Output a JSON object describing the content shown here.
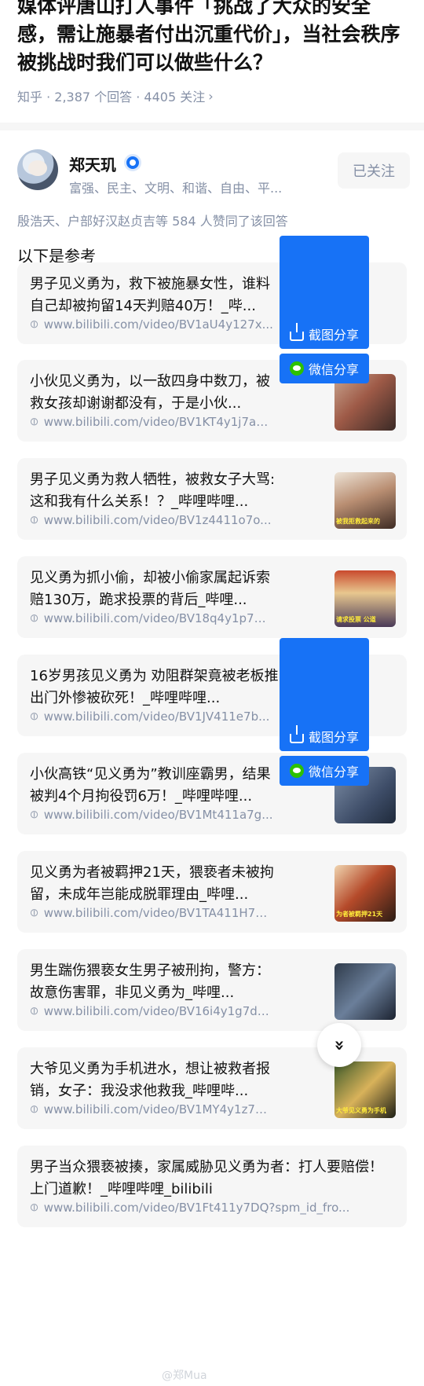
{
  "question": {
    "title": "媒体评唐山打人事件「挑战了大众的安全感，需让施暴者付出沉重代价」，当社会秩序被挑战时我们可以做些什么？",
    "meta": "知乎 · 2,387 个回答 · 4405 关注",
    "chevron": "›"
  },
  "author": {
    "name": "郑天玑",
    "bio": "富强、民主、文明、和谐、自由、平...",
    "follow_label": "已关注"
  },
  "likers": "殷浩天、户部好汉赵贞吉等 584 人赞同了该回答",
  "intro": "以下是参考",
  "cards": [
    {
      "title": "男子见义勇为，救下被施暴女性，谁料自己却被拘留14天判赔40万！_哔...",
      "url": "www.bilibili.com/video/BV1aU4y127x..."
    },
    {
      "title": "小伙见义勇为，以一敌四身中数刀，被救女孩却谢谢都没有，于是小伙...",
      "url": "www.bilibili.com/video/BV1KT4y1j7aV..."
    },
    {
      "title": "男子见义勇为救人牺牲，被救女子大骂:这和我有什么关系！？_哔哩哔哩...",
      "url": "www.bilibili.com/video/BV1z4411o7o..."
    },
    {
      "title": "见义勇为抓小偷，却被小偷家属起诉索赔130万，跪求投票的背后_哔哩...",
      "url": "www.bilibili.com/video/BV18q4y1p7U..."
    },
    {
      "title": "16岁男孩见义勇为 劝阻群架竟被老板推出门外惨被砍死！_哔哩哔哩...",
      "url": "www.bilibili.com/video/BV1JV411e7b..."
    },
    {
      "title": "小伙高铁“见义勇为”教训座霸男，结果被判4个月拘役罚6万！_哔哩哔哩...",
      "url": "www.bilibili.com/video/BV1Mt411a7g..."
    },
    {
      "title": "见义勇为者被羁押21天，猥亵者未被拘留，未成年岂能成脱罪理由_哔哩...",
      "url": "www.bilibili.com/video/BV1TA411H71..."
    },
    {
      "title": "男生踹伤猥亵女生男子被刑拘，警方：故意伤害罪，非见义勇为_哔哩...",
      "url": "www.bilibili.com/video/BV16i4y1g7da..."
    },
    {
      "title": "大爷见义勇为手机进水，想让被救者报销，女子：我没求他救我_哔哩哔...",
      "url": "www.bilibili.com/video/BV1MY4y1z7K..."
    },
    {
      "title": "男子当众猥亵被揍，家属威胁见义勇为者：打人要赔偿！上门道歉！_哔哩哔哩_bilibili",
      "url": "www.bilibili.com/video/BV1Ft411y7DQ?spm_id_fro..."
    }
  ],
  "thumb_captions": {
    "t3": "被我拒救起来的",
    "t4": "请求投票 公道",
    "t6": "为者被羁押21天",
    "t8": "大爷见义勇为手机"
  },
  "share": {
    "screenshot_label": "截图分享",
    "wechat_label": "微信分享"
  },
  "scroll_icon": "»",
  "watermark": "@郑Mua",
  "colors": {
    "accent": "#1772f6",
    "muted": "#8590a6",
    "card_bg": "#f6f6f6"
  }
}
